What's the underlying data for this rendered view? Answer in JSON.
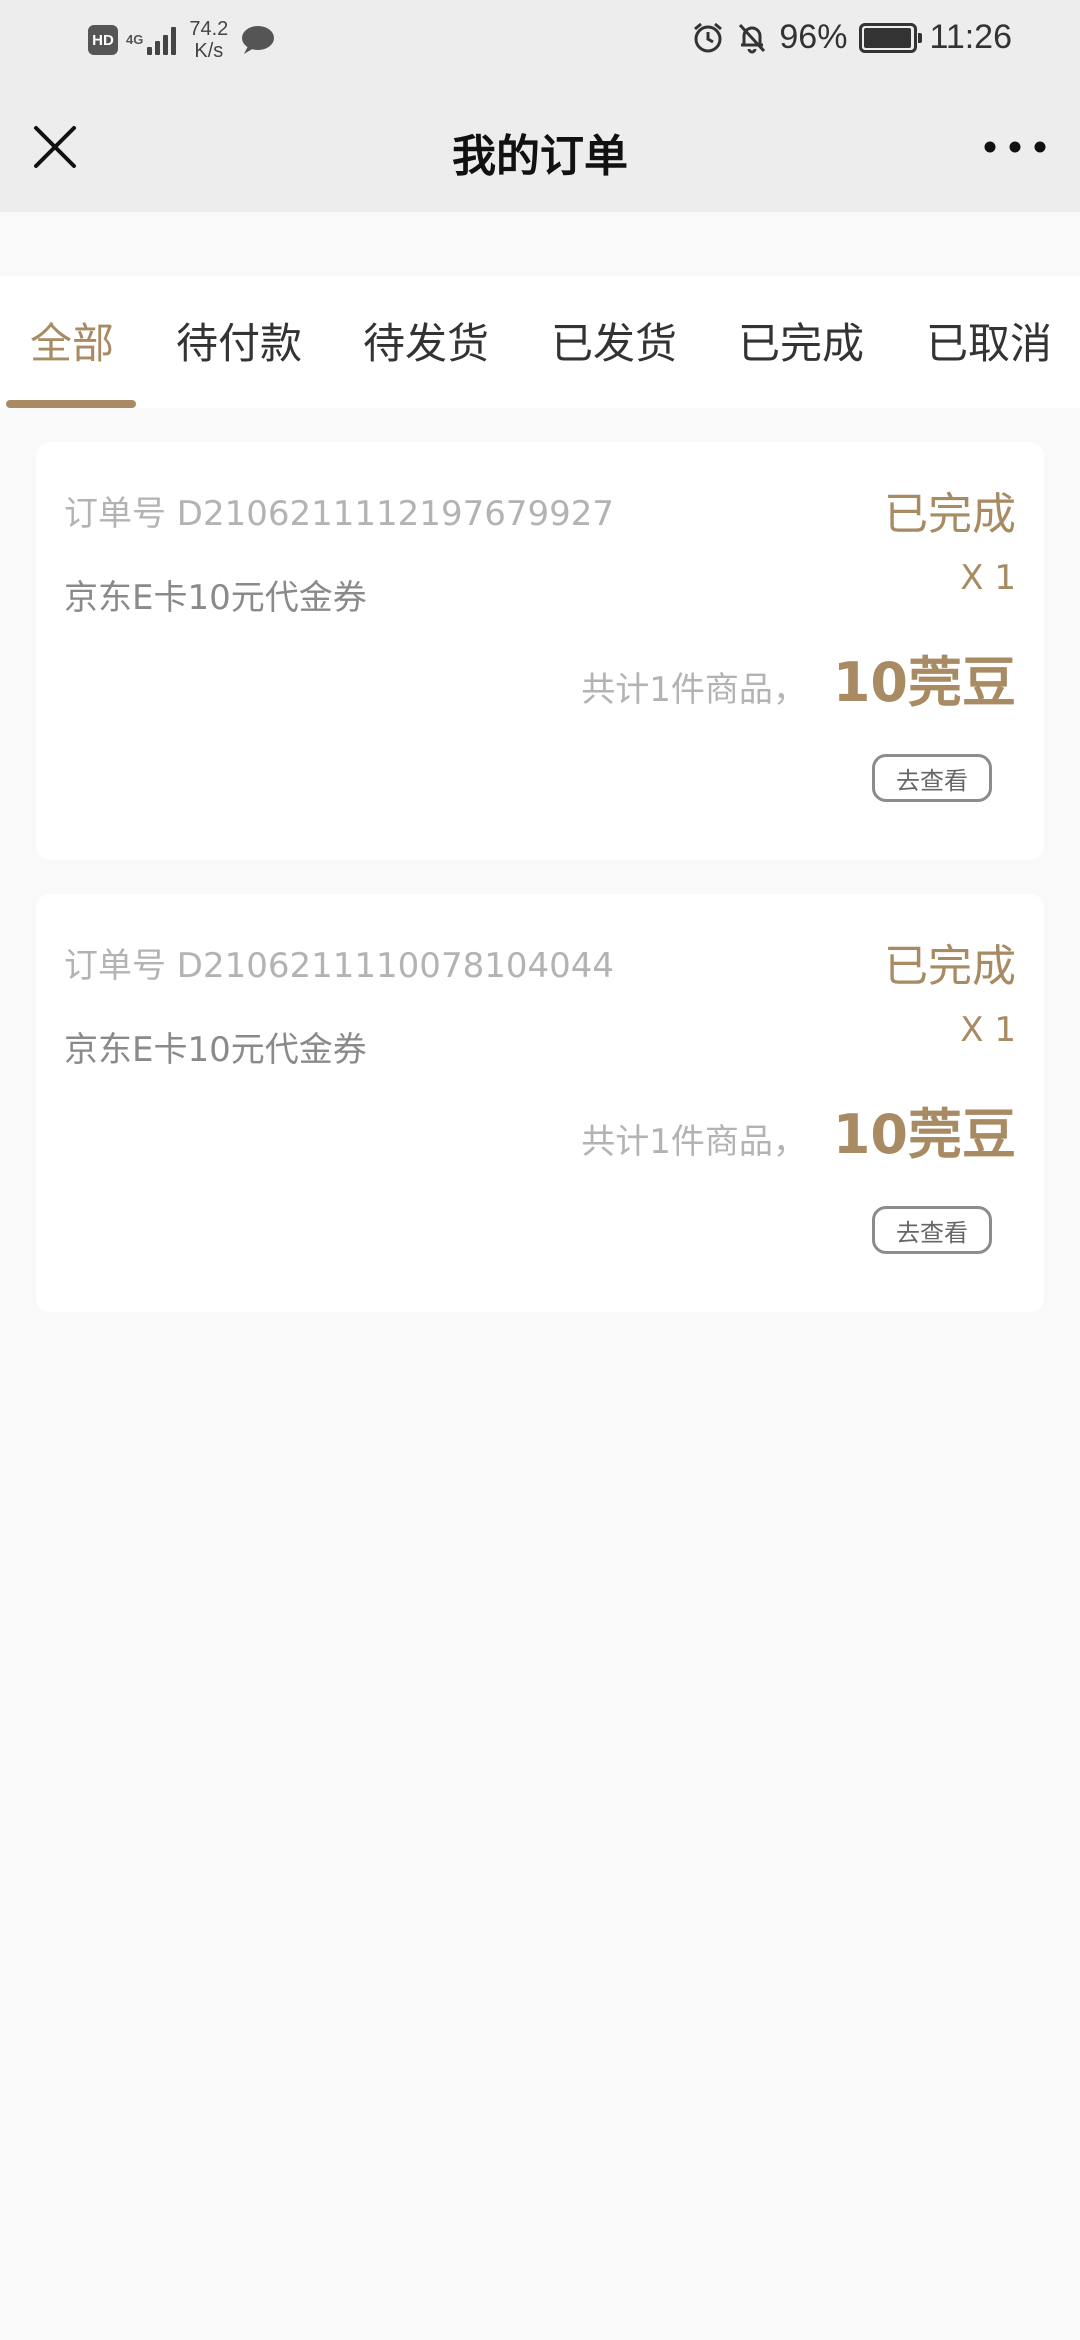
{
  "status_bar": {
    "hd_badge": "HD",
    "network_type": "4G",
    "speed_value": "74.2",
    "speed_unit": "K/s",
    "battery_percent": "96%",
    "time": "11:26"
  },
  "nav": {
    "title": "我的订单",
    "close_icon": "close-icon",
    "more_icon": "more-horizontal-icon"
  },
  "tabs": [
    {
      "label": "全部",
      "active": true
    },
    {
      "label": "待付款",
      "active": false
    },
    {
      "label": "待发货",
      "active": false
    },
    {
      "label": "已发货",
      "active": false
    },
    {
      "label": "已完成",
      "active": false
    },
    {
      "label": "已取消",
      "active": false
    }
  ],
  "orders": [
    {
      "order_no": "订单号 D2106211112197679927",
      "status": "已完成",
      "product_name": "京东E卡10元代金券",
      "quantity": "X 1",
      "total_label": "共计1件商品，",
      "total_amount": "10莞豆",
      "action_label": "去查看"
    },
    {
      "order_no": "订单号 D2106211110078104044",
      "status": "已完成",
      "product_name": "京东E卡10元代金券",
      "quantity": "X 1",
      "total_label": "共计1件商品，",
      "total_amount": "10莞豆",
      "action_label": "去查看"
    }
  ],
  "colors": {
    "accent": "#a88b63",
    "nav_background": "#ededed",
    "page_background": "#f9f9f9"
  }
}
